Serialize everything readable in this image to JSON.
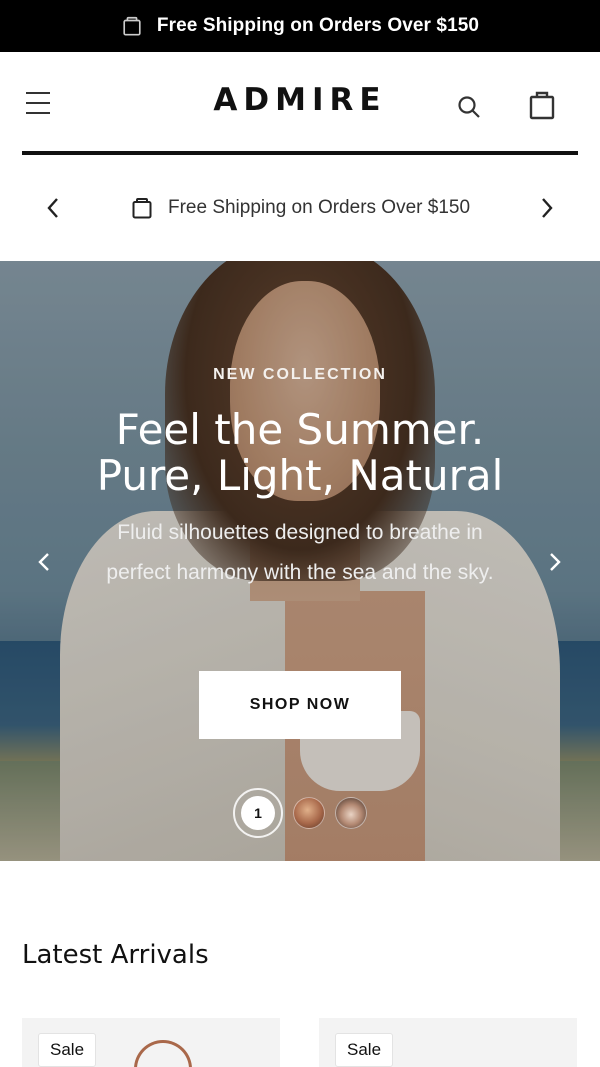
{
  "topbar": {
    "icon": "shopping-bag-icon",
    "text": "Free Shipping on Orders Over $150"
  },
  "header": {
    "logo": "ADMIRE",
    "menu_icon": "hamburger-menu-icon",
    "search_icon": "search-icon",
    "cart_icon": "shopping-bag-icon"
  },
  "announcement": {
    "icon": "shopping-bag-icon",
    "text": "Free Shipping on Orders Over $150",
    "prev_icon": "chevron-left-icon",
    "next_icon": "chevron-right-icon"
  },
  "hero": {
    "eyebrow": "NEW COLLECTION",
    "headline_line1": "Feel the Summer.",
    "headline_line2": "Pure, Light, Natural",
    "subtitle": "Fluid silhouettes designed to breathe in perfect harmony with the sea and the sky.",
    "cta": "SHOP NOW",
    "active_slide": "1",
    "slide_count": 3
  },
  "latest_arrivals": {
    "title": "Latest Arrivals",
    "products": [
      {
        "badge": "Sale"
      },
      {
        "badge": "Sale"
      }
    ]
  },
  "colors": {
    "topbar_bg": "#000000",
    "accent": "#111111",
    "card_bg": "#f3f3f3"
  }
}
